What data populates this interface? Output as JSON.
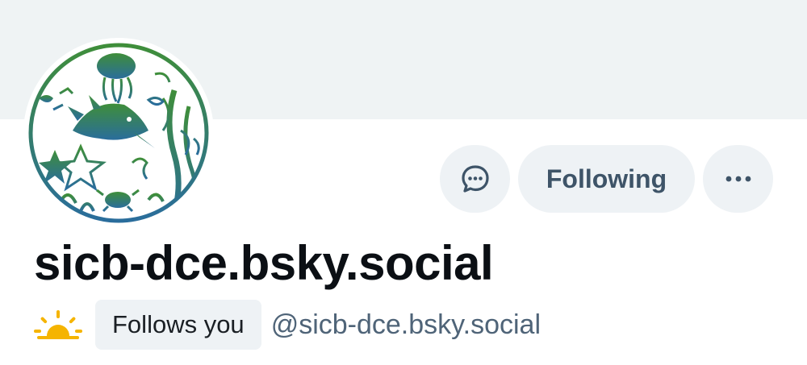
{
  "profile": {
    "display_name": "sicb-dce.bsky.social",
    "handle": "@sicb-dce.bsky.social",
    "follows_you_label": "Follows you",
    "avatar_icon": "circular green-blue nature illustration avatar",
    "status_icon": "sun-rise-icon"
  },
  "actions": {
    "chat_icon": "chat-bubble-icon",
    "following_label": "Following",
    "more_icon": "more-options-icon"
  },
  "colors": {
    "banner": "#eff3f4",
    "button_bg": "#eef2f5",
    "button_text": "#3e5468",
    "handle_text": "#4f6478",
    "avatar_green": "#3a8a3a",
    "avatar_blue": "#2a6f9a",
    "sun": "#f5b400"
  }
}
